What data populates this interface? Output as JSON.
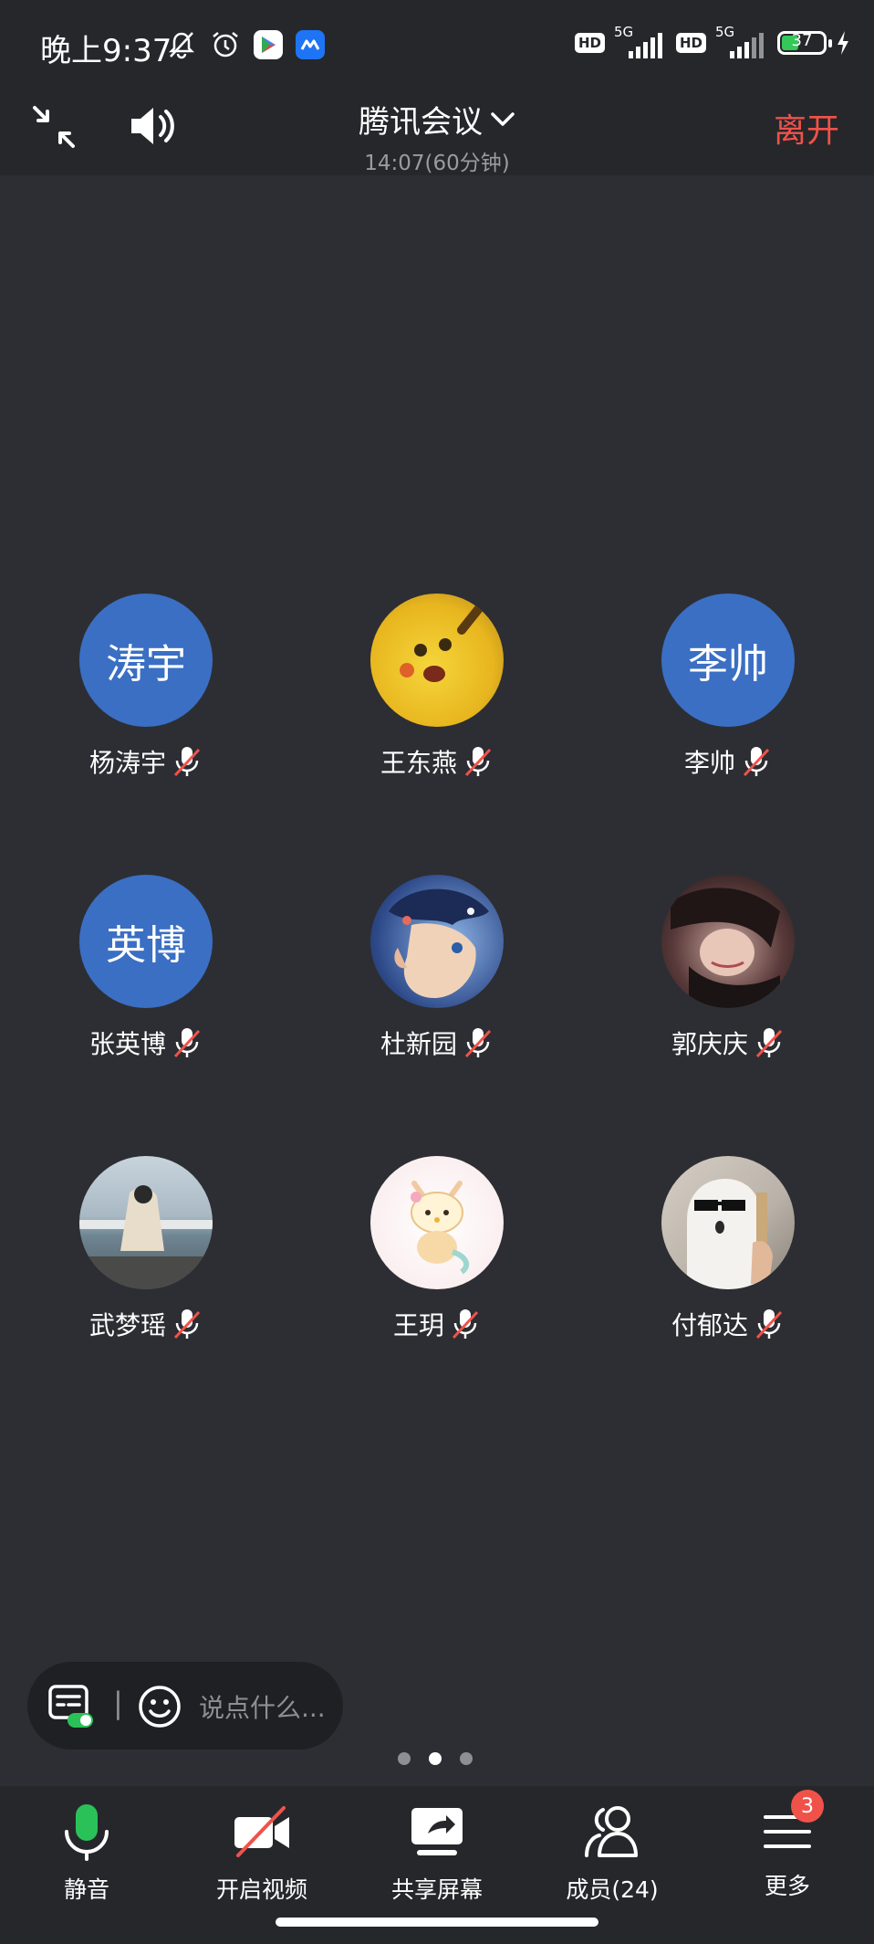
{
  "status_bar": {
    "time": "晚上9:37",
    "hd1": "HD",
    "net1": "5G",
    "hd2": "HD",
    "net2": "5G",
    "battery": "37"
  },
  "header": {
    "title": "腾讯会议",
    "duration": "14:07(60分钟)",
    "leave": "离开"
  },
  "participants": [
    {
      "name": "杨涛宇",
      "avatar_text": "涛宇",
      "avatar_color": "#3a6fc4"
    },
    {
      "name": "王东燕",
      "avatar_text": "",
      "avatar_color": "#e8c12a"
    },
    {
      "name": "李帅",
      "avatar_text": "李帅",
      "avatar_color": "#3a6fc4"
    },
    {
      "name": "张英博",
      "avatar_text": "英博",
      "avatar_color": "#3a6fc4"
    },
    {
      "name": "杜新园",
      "avatar_text": "",
      "avatar_color": "#2e4a8a"
    },
    {
      "name": "郭庆庆",
      "avatar_text": "",
      "avatar_color": "#3a2a2a"
    },
    {
      "name": "武梦瑶",
      "avatar_text": "",
      "avatar_color": "#8aa0b0"
    },
    {
      "name": "王玥",
      "avatar_text": "",
      "avatar_color": "#f6eee8"
    },
    {
      "name": "付郁达",
      "avatar_text": "",
      "avatar_color": "#b9b2a8"
    }
  ],
  "chat": {
    "separator": "|",
    "placeholder": "说点什么..."
  },
  "pager": {
    "current": 2,
    "total": 3
  },
  "toolbar": {
    "mute": "静音",
    "video": "开启视频",
    "share": "共享屏幕",
    "members": "成员(24)",
    "more": "更多",
    "more_badge": "3"
  },
  "colors": {
    "background": "#2d2e33",
    "bar": "#26272b",
    "accent_green": "#2bc159",
    "leave_red": "#f0524a",
    "avatar_blue": "#3a6fc4"
  }
}
